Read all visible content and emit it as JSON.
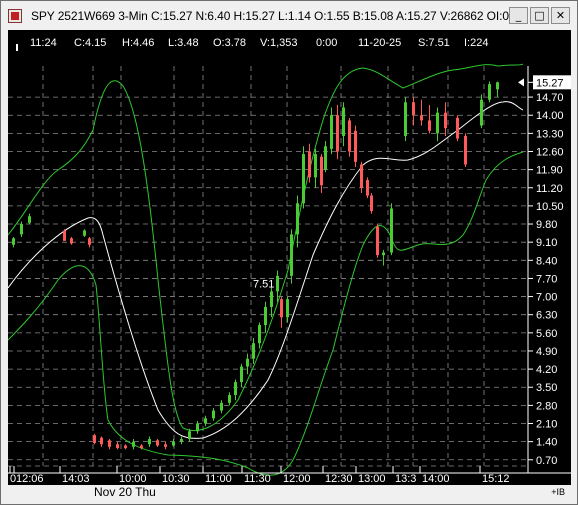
{
  "window": {
    "title": "SPY 2521W669 3-Min C:15.27 N:6.40 H:15.27 L:1.14 O:1.55 B:15.08 A:15.27 V:26862 OI:0",
    "minimize": "_",
    "maximize": "□",
    "close": "✕"
  },
  "quote_bar": {
    "time": "11:24",
    "close": "C:4.15",
    "high": "H:4.46",
    "low": "L:3.48",
    "open": "O:3.78",
    "volume": "V:1,353",
    "field": "0:00",
    "date": "11-20-25",
    "s_value": "S:7.51",
    "count": "I:224"
  },
  "bottom": {
    "ib_label": "+IB"
  },
  "chart_data": {
    "type": "candlestick",
    "y_ticks": [
      "15.27",
      "14.70",
      "14.00",
      "13.30",
      "12.60",
      "11.90",
      "11.20",
      "10.50",
      "9.80",
      "9.10",
      "8.40",
      "7.70",
      "7.00",
      "6.30",
      "5.60",
      "4.90",
      "4.20",
      "3.50",
      "2.80",
      "2.10",
      "1.40",
      "0.70"
    ],
    "y_tick_values": [
      15.27,
      14.7,
      14.0,
      13.3,
      12.6,
      11.9,
      11.2,
      10.5,
      9.8,
      9.1,
      8.4,
      7.7,
      7.0,
      6.3,
      5.6,
      4.9,
      4.2,
      3.5,
      2.8,
      2.1,
      1.4,
      0.7
    ],
    "ylim": [
      0.46,
      15.9
    ],
    "current_price_label": "15.27",
    "annotation": "7.51",
    "x_labels": [
      "0",
      "12:06",
      "14:03",
      "10:00",
      "10:30",
      "11:00",
      "11:30",
      "12:00",
      "12:30",
      "13:00",
      "13:3",
      "14:00",
      "15:12"
    ],
    "date_label": "Nov 20 Thu",
    "colors": {
      "up": "#4ccc34",
      "down": "#ff5a5a",
      "band": "#2ec82e",
      "ma": "#ffffff",
      "grid": "#8a8a8a"
    }
  }
}
